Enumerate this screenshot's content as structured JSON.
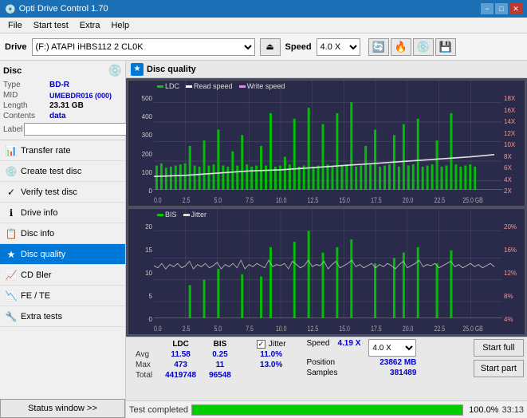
{
  "app": {
    "title": "Opti Drive Control 1.70",
    "minimize": "−",
    "maximize": "□",
    "close": "✕"
  },
  "menu": {
    "items": [
      "File",
      "Start test",
      "Extra",
      "Help"
    ]
  },
  "drivebar": {
    "label": "Drive",
    "drive_value": "(F:)  ATAPI iHBS112  2 CL0K",
    "speed_label": "Speed",
    "speed_value": "4.0 X"
  },
  "disc": {
    "title": "Disc",
    "type_label": "Type",
    "type_value": "BD-R",
    "mid_label": "MID",
    "mid_value": "UMEBDR016 (000)",
    "length_label": "Length",
    "length_value": "23.31 GB",
    "contents_label": "Contents",
    "contents_value": "data",
    "label_label": "Label"
  },
  "nav": {
    "items": [
      {
        "id": "transfer-rate",
        "label": "Transfer rate",
        "icon": "📊"
      },
      {
        "id": "create-test-disc",
        "label": "Create test disc",
        "icon": "💿"
      },
      {
        "id": "verify-test-disc",
        "label": "Verify test disc",
        "icon": "✓"
      },
      {
        "id": "drive-info",
        "label": "Drive info",
        "icon": "ℹ"
      },
      {
        "id": "disc-info",
        "label": "Disc info",
        "icon": "📋"
      },
      {
        "id": "disc-quality",
        "label": "Disc quality",
        "icon": "★",
        "active": true
      },
      {
        "id": "cd-bler",
        "label": "CD Bler",
        "icon": "📈"
      },
      {
        "id": "fe-te",
        "label": "FE / TE",
        "icon": "📉"
      },
      {
        "id": "extra-tests",
        "label": "Extra tests",
        "icon": "🔧"
      }
    ],
    "status_btn": "Status window >>"
  },
  "disc_quality": {
    "title": "Disc quality",
    "chart1": {
      "legend": [
        {
          "label": "LDC",
          "color": "#00cc00"
        },
        {
          "label": "Read speed",
          "color": "#ffffff"
        },
        {
          "label": "Write speed",
          "color": "#ff77ff"
        }
      ],
      "y_left": [
        "500",
        "400",
        "300",
        "200",
        "100",
        "0"
      ],
      "y_right": [
        "18X",
        "16X",
        "14X",
        "12X",
        "10X",
        "8X",
        "6X",
        "4X",
        "2X"
      ],
      "x_labels": [
        "0.0",
        "2.5",
        "5.0",
        "7.5",
        "10.0",
        "12.5",
        "15.0",
        "17.5",
        "20.0",
        "22.5",
        "25.0 GB"
      ]
    },
    "chart2": {
      "legend": [
        {
          "label": "BIS",
          "color": "#00cc00"
        },
        {
          "label": "Jitter",
          "color": "#ffffff"
        }
      ],
      "y_left": [
        "20",
        "15",
        "10",
        "5",
        "0"
      ],
      "y_right": [
        "20%",
        "16%",
        "12%",
        "8%",
        "4%"
      ],
      "x_labels": [
        "0.0",
        "2.5",
        "5.0",
        "7.5",
        "10.0",
        "12.5",
        "15.0",
        "17.5",
        "20.0",
        "22.5",
        "25.0 GB"
      ]
    },
    "stats": {
      "headers": [
        "",
        "LDC",
        "BIS",
        "",
        "Jitter",
        "Speed",
        "",
        ""
      ],
      "avg_label": "Avg",
      "avg_ldc": "11.58",
      "avg_bis": "0.25",
      "avg_jitter": "11.0%",
      "max_label": "Max",
      "max_ldc": "473",
      "max_bis": "11",
      "max_jitter": "13.0%",
      "total_label": "Total",
      "total_ldc": "4419748",
      "total_bis": "96548",
      "speed_label": "Speed",
      "speed_value": "4.19 X",
      "position_label": "Position",
      "position_value": "23862 MB",
      "samples_label": "Samples",
      "samples_value": "381489",
      "jitter_checked": true,
      "speed_dropdown": "4.0 X",
      "btn_start_full": "Start full",
      "btn_start_part": "Start part"
    }
  },
  "progress": {
    "label": "Test completed",
    "percent": 100,
    "percent_text": "100.0%",
    "time": "33:13"
  },
  "colors": {
    "accent_blue": "#0078d7",
    "progress_green": "#00cc00",
    "chart_bg": "#2a2a4a",
    "ldc_color": "#00cc00",
    "bis_color": "#00cc00",
    "speed_color": "#ffffff",
    "jitter_color": "#dddddd"
  }
}
